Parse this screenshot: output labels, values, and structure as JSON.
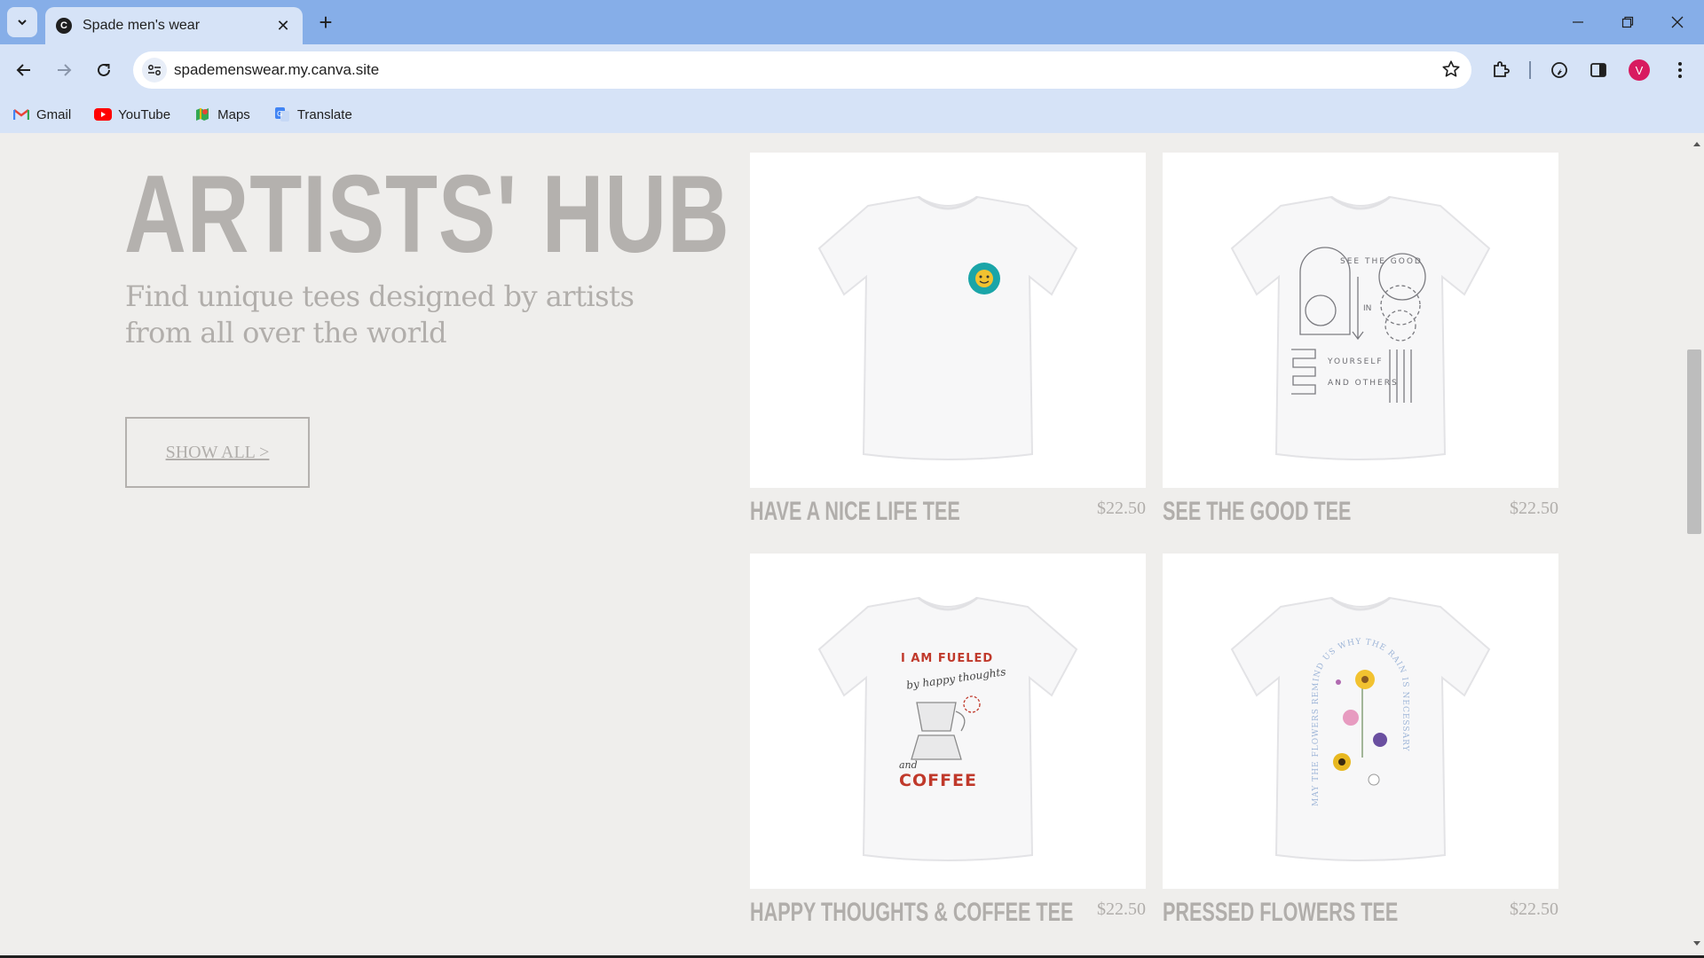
{
  "browser": {
    "tab_title": "Spade men's wear",
    "favicon_letter": "C",
    "url": "spademenswear.my.canva.site",
    "avatar_letter": "V",
    "bookmarks": [
      {
        "label": "Gmail",
        "icon": "gmail-icon"
      },
      {
        "label": "YouTube",
        "icon": "youtube-icon"
      },
      {
        "label": "Maps",
        "icon": "maps-icon"
      },
      {
        "label": "Translate",
        "icon": "translate-icon"
      }
    ]
  },
  "hero": {
    "title": "ARTISTS' HUB",
    "subtitle": "Find unique tees designed by artists from all over the world",
    "button": "SHOW ALL >"
  },
  "products": [
    {
      "name": "HAVE A NICE LIFE TEE",
      "price": "$22.50"
    },
    {
      "name": "SEE THE GOOD TEE",
      "price": "$22.50"
    },
    {
      "name": "HAPPY THOUGHTS & COFFEE TEE",
      "price": "$22.50"
    },
    {
      "name": "PRESSED FLOWERS TEE",
      "price": "$22.50"
    }
  ],
  "shirt_prints": {
    "good_tee_text_1": "SEE THE GOOD",
    "good_tee_text_2": "IN",
    "good_tee_text_3": "YOURSELF",
    "good_tee_text_4": "AND OTHERS",
    "coffee_text_1": "I AM FUELED",
    "coffee_text_2": "by happy thoughts",
    "coffee_text_3": "and",
    "coffee_text_4": "COFFEE",
    "flowers_text": "MAY THE FLOWERS REMIND US WHY THE RAIN IS NECESSARY"
  },
  "colors": {
    "chrome_tabbar": "#86aee8",
    "chrome_toolbar": "#d6e3f7",
    "page_bg": "#efeeec",
    "muted_text": "#b1aeab",
    "smiley_teal": "#1aa5a8",
    "smiley_yellow": "#f2c230",
    "coffee_red": "#c0392b"
  }
}
